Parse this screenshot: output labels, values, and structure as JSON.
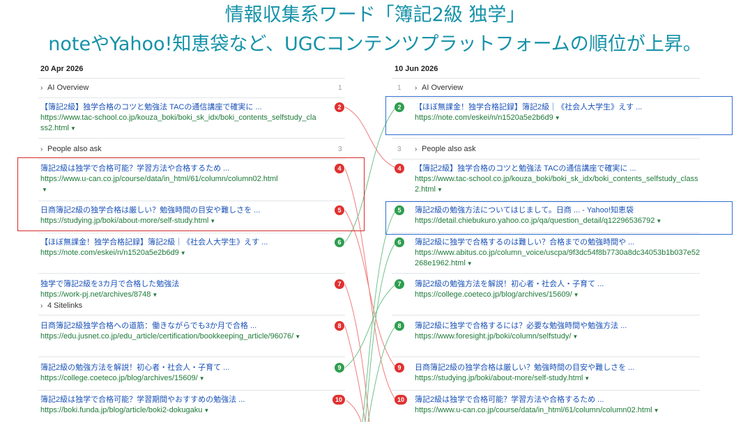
{
  "heading": {
    "line1": "情報収集系ワード「簿記2級 独学」",
    "line2": "noteやYahoo!知恵袋など、UGCコンテンツプラットフォームの順位が上昇。"
  },
  "left": {
    "date": "20 Apr 2026",
    "ai_overview": {
      "label": "AI Overview",
      "num": "1"
    },
    "paa": {
      "label": "People also ask",
      "num": "3"
    },
    "sitelinks": {
      "label": "4 Sitelinks"
    },
    "results": [
      {
        "rank": "2",
        "title": "【簿記2級】独学合格のコツと勉強法 TACの通信講座で確実に ...",
        "url": "https://www.tac-school.co.jp/kouza_boki/boki_sk_idx/boki_contents_selfstudy_class2.html"
      },
      {
        "rank": "4",
        "title": "簿記2級は独学で合格可能？学習方法や合格するため ...",
        "url": "https://www.u-can.co.jp/course/data/in_html/61/column/column02.html"
      },
      {
        "rank": "5",
        "title": "日商簿記2級の独学合格は厳しい？勉強時間の目安や難しさを ...",
        "url": "https://studying.jp/boki/about-more/self-study.html"
      },
      {
        "rank": "6",
        "title": "【ほぼ無課金！独学合格記録】簿記2級｜《社会人大学生》えす ...",
        "url": "https://note.com/eskei/n/n1520a5e2b6d9"
      },
      {
        "rank": "7",
        "title": "独学で簿記2級を3カ月で合格した勉強法",
        "url": "https://work-pj.net/archives/8748"
      },
      {
        "rank": "8",
        "title": "日商簿記2級独学合格への道筋：働きながらでも3か月で合格 ...",
        "url": "https://edu.jusnet.co.jp/edu_article/certification/bookkeeping_article/96076/"
      },
      {
        "rank": "9",
        "title": "簿記2級の勉強方法を解説！初心者・社会人・子育て ...",
        "url": "https://college.coeteco.jp/blog/archives/15609/"
      },
      {
        "rank": "10",
        "title": "簿記2級は独学で合格可能？学習期間やおすすめの勉強法 ...",
        "url": "https://boki.funda.jp/blog/article/boki2-dokugaku"
      }
    ]
  },
  "right": {
    "date": "10 Jun 2026",
    "ai_overview": {
      "label": "AI Overview",
      "num": "1"
    },
    "paa": {
      "label": "People also ask",
      "num": "3"
    },
    "results": [
      {
        "rank": "2",
        "title": "【ほぼ無課金！独学合格記録】簿記2級｜《社会人大学生》えす ...",
        "url": "https://note.com/eskei/n/n1520a5e2b6d9"
      },
      {
        "rank": "4",
        "title": "【簿記2級】独学合格のコツと勉強法 TACの通信講座で確実に ...",
        "url": "https://www.tac-school.co.jp/kouza_boki/boki_sk_idx/boki_contents_selfstudy_class2.html"
      },
      {
        "rank": "5",
        "title": "簿記2級の勉強方法についてはじまして。日商 ... - Yahoo!知恵袋",
        "url": "https://detail.chiebukuro.yahoo.co.jp/qa/question_detail/q12296536792"
      },
      {
        "rank": "6",
        "title": "簿記2級に独学で合格するのは難しい？合格までの勉強時間や ...",
        "url": "https://www.abitus.co.jp/column_voice/uscpa/9f3dc54f8b7730a8dc34053b1b037e52268e1962.html"
      },
      {
        "rank": "7",
        "title": "簿記2級の勉強方法を解説！初心者・社会人・子育て ...",
        "url": "https://college.coeteco.jp/blog/archives/15609/"
      },
      {
        "rank": "8",
        "title": "簿記2級に独学で合格するには？必要な勉強時間や勉強方法 ...",
        "url": "https://www.foresight.jp/boki/column/selfstudy/"
      },
      {
        "rank": "9",
        "title": "日商簿記2級の独学合格は厳しい？勉強時間の目安や難しさを ...",
        "url": "https://studying.jp/boki/about-more/self-study.html"
      },
      {
        "rank": "10",
        "title": "簿記2級は独学で合格可能？学習方法や合格するため ...",
        "url": "https://www.u-can.co.jp/course/data/in_html/61/column/column02.html"
      }
    ]
  },
  "colors": {
    "heading": "#1592a8",
    "down": "#e03131",
    "up": "#2e9e4f",
    "highlight_drop": "#d62828",
    "highlight_rise": "#2f6fd1"
  },
  "icons": {
    "expand": "chevron-right-icon",
    "url_menu": "caret-down-icon"
  }
}
